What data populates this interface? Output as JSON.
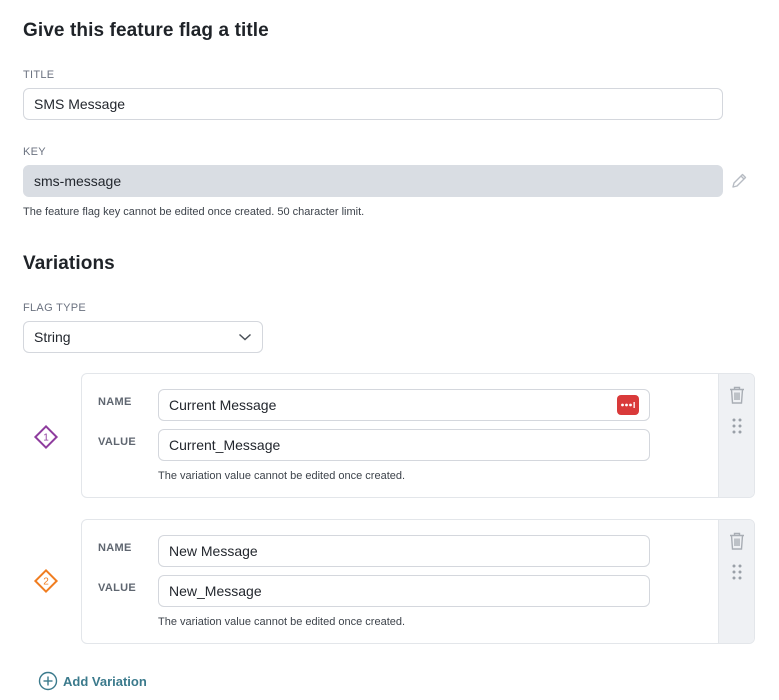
{
  "section1": {
    "heading": "Give this feature flag a title"
  },
  "title": {
    "label": "TITLE",
    "value": "SMS Message"
  },
  "key": {
    "label": "KEY",
    "value": "sms-message",
    "help": "The feature flag key cannot be edited once created. 50 character limit."
  },
  "section2": {
    "heading": "Variations"
  },
  "flag_type": {
    "label": "FLAG TYPE",
    "selected": "String"
  },
  "variations": [
    {
      "index": "1",
      "name_label": "NAME",
      "name": "Current Message",
      "value_label": "VALUE",
      "value": "Current_Message",
      "help": "The variation value cannot be edited once created.",
      "color": "#8e3c9e"
    },
    {
      "index": "2",
      "name_label": "NAME",
      "name": "New Message",
      "value_label": "VALUE",
      "value": "New_Message",
      "help": "The variation value cannot be edited once created.",
      "color": "#f07d20"
    }
  ],
  "add_variation": {
    "label": "Add Variation"
  },
  "colors": {
    "accent": "#3b7a8c",
    "password_badge": "#d93a3a"
  },
  "icons": {
    "edit": "pencil-icon",
    "delete": "trash-icon",
    "drag": "drag-handle-icon",
    "dropdown": "chevron-down-icon",
    "add": "plus-circle-icon",
    "password": "password-manager-icon"
  }
}
